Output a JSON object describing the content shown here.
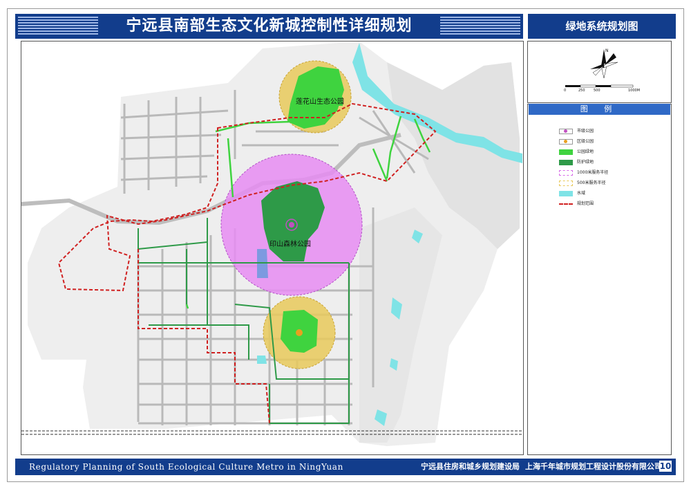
{
  "header": {
    "title": "宁远县南部生态文化新城控制性详细规划",
    "drawing_name": "绿地系统规划图"
  },
  "map": {
    "labels": {
      "lianhuashan_park": "莲花山生态公园",
      "yinshan_park": "印山森林公园"
    },
    "colors": {
      "city_park_radius": "#d86ee8",
      "district_park_radius": "#e8c95a",
      "park_green": "#3fd33f",
      "buffer_green": "#2e9a48",
      "water": "#7fe3e6",
      "boundary": "#d02020"
    }
  },
  "compass": {
    "north_label": "N"
  },
  "scale_bar": {
    "ticks": [
      "0",
      "250",
      "500",
      "1000M"
    ]
  },
  "legend": {
    "title": "图    例",
    "items": [
      {
        "label": "市级公园",
        "icon": "city-park-symbol",
        "color": "#c050c0"
      },
      {
        "label": "区级公园",
        "icon": "district-park-symbol",
        "color": "#e8a020"
      },
      {
        "label": "公园绿地",
        "icon": "park-green-swatch",
        "color": "#3fd33f"
      },
      {
        "label": "防护绿地",
        "icon": "buffer-green-swatch",
        "color": "#2e9a48"
      },
      {
        "label": "1000米服务半径",
        "icon": "radius-1000-swatch",
        "color": "#d86ee8"
      },
      {
        "label": "500米服务半径",
        "icon": "radius-500-swatch",
        "color": "#e8c95a"
      },
      {
        "label": "水域",
        "icon": "water-swatch",
        "color": "#7fe3e6"
      },
      {
        "label": "规划范围",
        "icon": "boundary-line-swatch",
        "color": "#d02020"
      }
    ]
  },
  "footer": {
    "english_title": "Regulatory Planning of South Ecological Culture Metro in NingYuan",
    "org1": "宁远县住房和城乡规划建设局",
    "org2": "上海千年城市规划工程设计股份有限公司",
    "page_number": "10"
  }
}
